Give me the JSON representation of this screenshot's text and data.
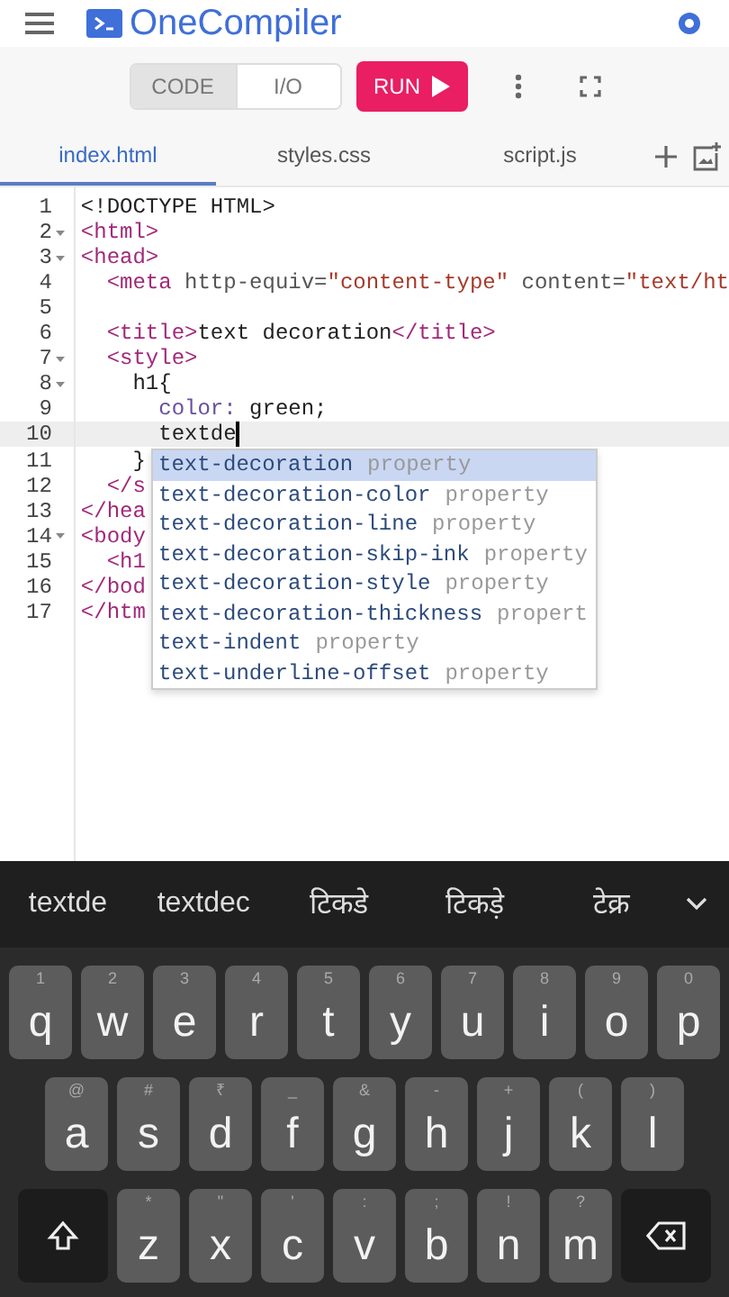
{
  "app": {
    "title": "OneCompiler"
  },
  "view_toggle": [
    {
      "label": "CODE",
      "selected": true
    },
    {
      "label": "I/O",
      "selected": false
    }
  ],
  "run_button": {
    "label": "RUN"
  },
  "file_tabs": [
    {
      "label": "index.html",
      "selected": true
    },
    {
      "label": "styles.css",
      "selected": false
    },
    {
      "label": "script.js",
      "selected": false
    }
  ],
  "editor": {
    "lines": [
      {
        "number": "1",
        "foldable": false,
        "active": false,
        "tokens": [
          {
            "kind": "text",
            "text": "<!DOCTYPE HTML>"
          }
        ]
      },
      {
        "number": "2",
        "foldable": true,
        "active": false,
        "tokens": [
          {
            "kind": "tag",
            "text": "<html>"
          }
        ]
      },
      {
        "number": "3",
        "foldable": true,
        "active": false,
        "tokens": [
          {
            "kind": "tag",
            "text": "<head>"
          }
        ]
      },
      {
        "number": "4",
        "foldable": false,
        "active": false,
        "tokens": [
          {
            "kind": "tag",
            "text": "  <meta "
          },
          {
            "kind": "attr",
            "text": "http-equiv="
          },
          {
            "kind": "string",
            "text": "\"content-type\""
          },
          {
            "kind": "attr",
            "text": " content="
          },
          {
            "kind": "string",
            "text": "\"text/ht"
          }
        ]
      },
      {
        "number": "5",
        "foldable": false,
        "active": false
      },
      {
        "number": "6",
        "foldable": false,
        "active": false,
        "tokens": [
          {
            "kind": "tag",
            "text": "  <title>"
          },
          {
            "kind": "text",
            "text": "text decoration"
          },
          {
            "kind": "tag",
            "text": "</title>"
          }
        ]
      },
      {
        "number": "7",
        "foldable": true,
        "active": false,
        "tokens": [
          {
            "kind": "tag",
            "text": "  <style>"
          }
        ]
      },
      {
        "number": "8",
        "foldable": true,
        "active": false,
        "tokens": [
          {
            "kind": "text",
            "text": "    h1{"
          }
        ]
      },
      {
        "number": "9",
        "foldable": false,
        "active": false,
        "tokens": [
          {
            "kind": "prop",
            "text": "      color: "
          },
          {
            "kind": "text",
            "text": "green;"
          }
        ]
      },
      {
        "number": "10",
        "foldable": false,
        "active": true,
        "tokens": [
          {
            "kind": "text",
            "text": "      textde"
          }
        ]
      },
      {
        "number": "11",
        "foldable": false,
        "active": false,
        "tokens": [
          {
            "kind": "text",
            "text": "    }"
          }
        ]
      },
      {
        "number": "12",
        "foldable": false,
        "active": false,
        "tokens": [
          {
            "kind": "tag",
            "text": "  </s"
          }
        ]
      },
      {
        "number": "13",
        "foldable": false,
        "active": false,
        "tokens": [
          {
            "kind": "tag",
            "text": "</hea"
          }
        ]
      },
      {
        "number": "14",
        "foldable": true,
        "active": false,
        "tokens": [
          {
            "kind": "tag",
            "text": "<body"
          }
        ]
      },
      {
        "number": "15",
        "foldable": false,
        "active": false,
        "tokens": [
          {
            "kind": "tag",
            "text": "  <h1"
          }
        ]
      },
      {
        "number": "16",
        "foldable": false,
        "active": false,
        "tokens": [
          {
            "kind": "tag",
            "text": "</bod"
          }
        ]
      },
      {
        "number": "17",
        "foldable": false,
        "active": false,
        "tokens": [
          {
            "kind": "tag",
            "text": "</htm"
          }
        ]
      }
    ]
  },
  "autocomplete": [
    {
      "name": "text-decoration",
      "type": "property",
      "selected": true
    },
    {
      "name": "text-decoration-color",
      "type": "property",
      "selected": false
    },
    {
      "name": "text-decoration-line",
      "type": "property",
      "selected": false
    },
    {
      "name": "text-decoration-skip-ink",
      "type": "property",
      "selected": false
    },
    {
      "name": "text-decoration-style",
      "type": "property",
      "selected": false
    },
    {
      "name": "text-decoration-thickness",
      "type": "propert",
      "selected": false
    },
    {
      "name": "text-indent",
      "type": "property",
      "selected": false
    },
    {
      "name": "text-underline-offset",
      "type": "property",
      "selected": false
    }
  ],
  "keyboard": {
    "suggestions": [
      "textde",
      "textdec",
      "टिकडे",
      "टिकड़े",
      "टेक्र"
    ],
    "rows": [
      [
        {
          "kind": "letter",
          "label": "q",
          "hint": "1"
        },
        {
          "kind": "letter",
          "label": "w",
          "hint": "2"
        },
        {
          "kind": "letter",
          "label": "e",
          "hint": "3"
        },
        {
          "kind": "letter",
          "label": "r",
          "hint": "4"
        },
        {
          "kind": "letter",
          "label": "t",
          "hint": "5"
        },
        {
          "kind": "letter",
          "label": "y",
          "hint": "6"
        },
        {
          "kind": "letter",
          "label": "u",
          "hint": "7"
        },
        {
          "kind": "letter",
          "label": "i",
          "hint": "8"
        },
        {
          "kind": "letter",
          "label": "o",
          "hint": "9"
        },
        {
          "kind": "letter",
          "label": "p",
          "hint": "0"
        }
      ],
      [
        {
          "kind": "letter",
          "label": "a",
          "hint": "@"
        },
        {
          "kind": "letter",
          "label": "s",
          "hint": "#"
        },
        {
          "kind": "letter",
          "label": "d",
          "hint": "₹"
        },
        {
          "kind": "letter",
          "label": "f",
          "hint": "_"
        },
        {
          "kind": "letter",
          "label": "g",
          "hint": "&"
        },
        {
          "kind": "letter",
          "label": "h",
          "hint": "-"
        },
        {
          "kind": "letter",
          "label": "j",
          "hint": "+"
        },
        {
          "kind": "letter",
          "label": "k",
          "hint": "("
        },
        {
          "kind": "letter",
          "label": "l",
          "hint": ")"
        }
      ],
      [
        {
          "kind": "shift"
        },
        {
          "kind": "letter",
          "label": "z",
          "hint": "*"
        },
        {
          "kind": "letter",
          "label": "x",
          "hint": "\""
        },
        {
          "kind": "letter",
          "label": "c",
          "hint": "'"
        },
        {
          "kind": "letter",
          "label": "v",
          "hint": ":"
        },
        {
          "kind": "letter",
          "label": "b",
          "hint": ";"
        },
        {
          "kind": "letter",
          "label": "n",
          "hint": "!"
        },
        {
          "kind": "letter",
          "label": "m",
          "hint": "?"
        },
        {
          "kind": "backspace"
        }
      ]
    ]
  }
}
